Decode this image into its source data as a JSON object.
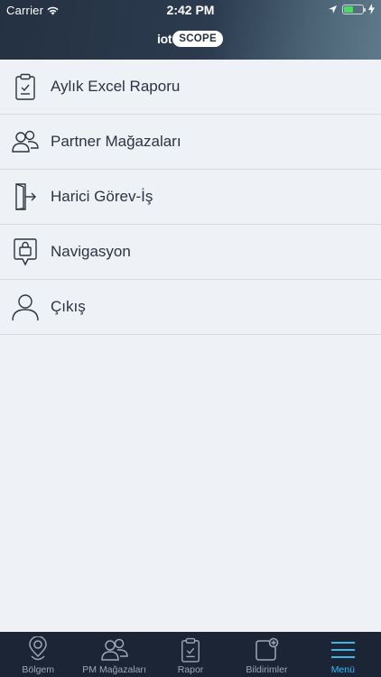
{
  "status_bar": {
    "carrier": "Carrier",
    "time": "2:42 PM"
  },
  "header": {
    "logo_prefix": "iot",
    "logo_word": "SCOPE"
  },
  "menu": {
    "items": [
      {
        "label": "Aylık Excel Raporu",
        "icon": "clipboard-check-icon"
      },
      {
        "label": "Partner Mağazaları",
        "icon": "users-icon"
      },
      {
        "label": "Harici Görev-İş",
        "icon": "door-exit-icon"
      },
      {
        "label": "Navigasyon",
        "icon": "shopping-bag-pin-icon"
      },
      {
        "label": "Çıkış",
        "icon": "user-icon"
      }
    ]
  },
  "tabbar": {
    "tabs": [
      {
        "label": "Bölgem",
        "icon": "map-pin-icon",
        "active": false
      },
      {
        "label": "PM Mağazaları",
        "icon": "users-icon",
        "active": false
      },
      {
        "label": "Rapor",
        "icon": "clipboard-check-icon",
        "active": false
      },
      {
        "label": "Bildirimler",
        "icon": "notification-icon",
        "active": false
      },
      {
        "label": "Menü",
        "icon": "hamburger-menu-icon",
        "active": true
      }
    ]
  },
  "colors": {
    "accent": "#3fb6e8",
    "tabbar_bg": "#1c2535",
    "page_bg": "#eef1f5",
    "text": "#2b3440"
  }
}
